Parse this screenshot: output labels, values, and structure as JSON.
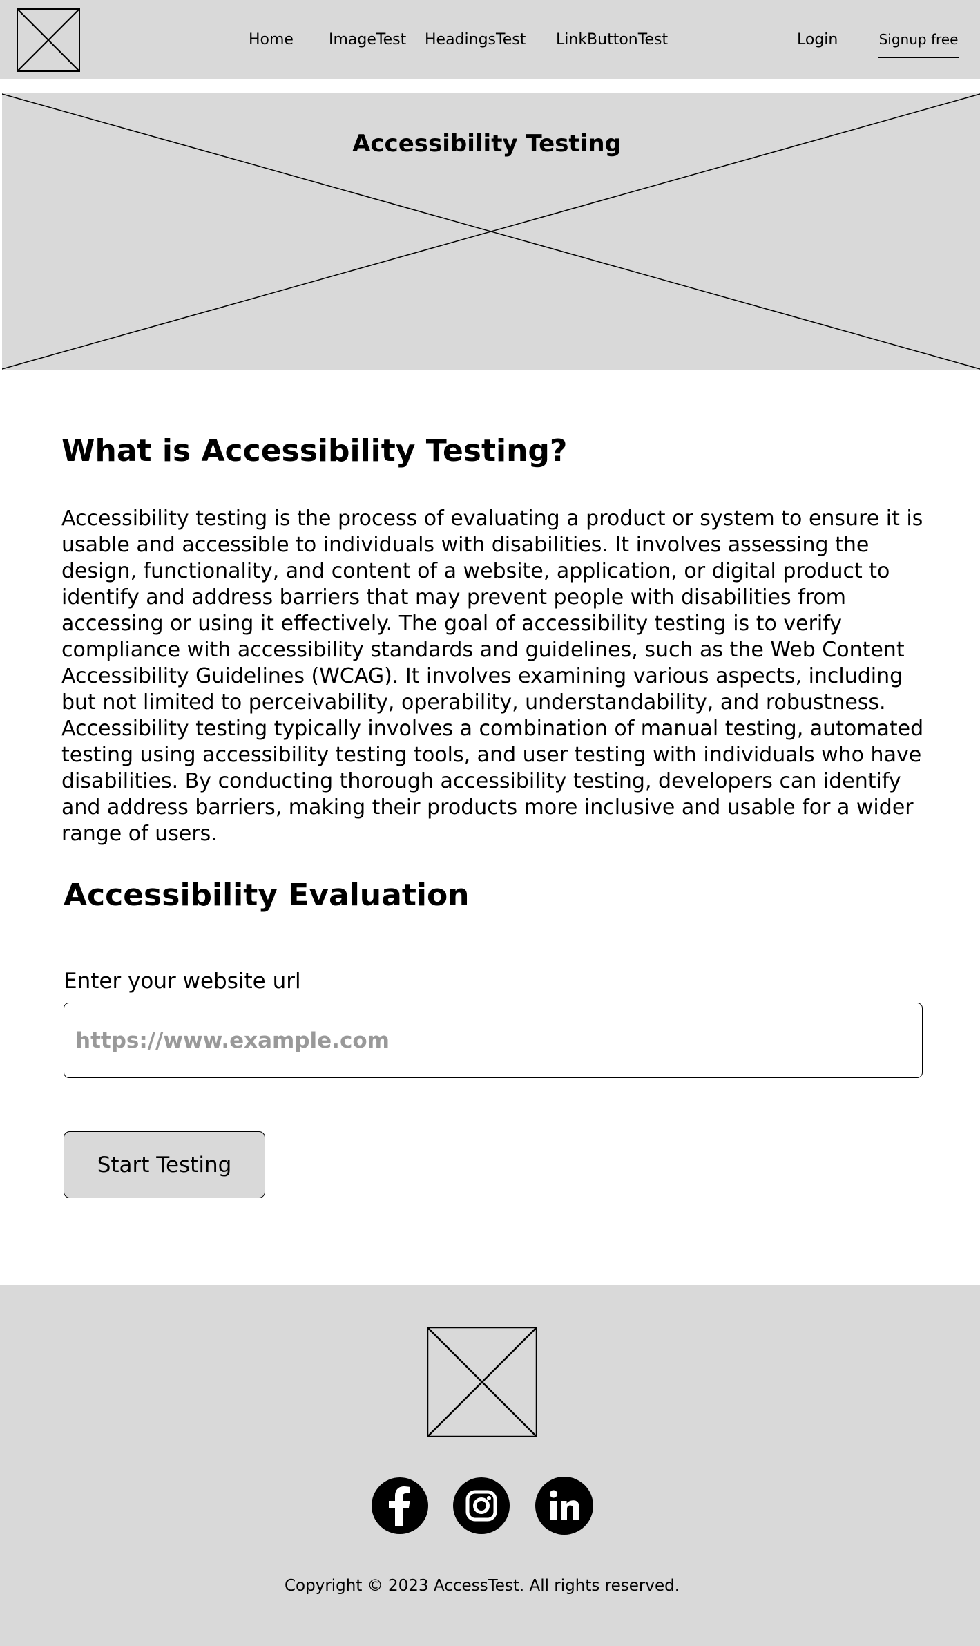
{
  "header": {
    "logo_icon": "image-placeholder-icon",
    "nav": [
      "Home",
      "ImageTest",
      "HeadingsTest",
      "LinkButtonTest"
    ],
    "login": "Login",
    "signup": "Signup free"
  },
  "hero": {
    "image_icon": "image-placeholder-icon",
    "title": "Accessibility Testing"
  },
  "main": {
    "heading": "What is Accessibility Testing?",
    "paragraph": "Accessibility testing is the process of evaluating a product or system to ensure it is usable and accessible to individuals with disabilities. It involves assessing the design, functionality, and content of a website, application, or digital product to identify and address barriers that may prevent people with disabilities from accessing or using it effectively. The goal of accessibility testing is to verify compliance with accessibility standards and guidelines, such as the Web Content Accessibility Guidelines (WCAG). It involves examining various aspects, including but not limited to perceivability, operability, understandability, and robustness. Accessibility testing typically involves a combination of manual testing, automated testing using accessibility testing tools, and user testing with individuals who have disabilities. By conducting thorough accessibility testing, developers can identify and address barriers, making their products more inclusive and usable for a wider range of users."
  },
  "evaluation": {
    "heading": "Accessibility Evaluation",
    "input_label": "Enter your website url",
    "input_placeholder": "https://www.example.com",
    "input_value": "",
    "button": "Start Testing"
  },
  "footer": {
    "logo_icon": "image-placeholder-icon",
    "social_icons": [
      "facebook-icon",
      "instagram-icon",
      "linkedin-icon"
    ],
    "copyright": "Copyright © 2023 AccessTest. All rights reserved."
  },
  "colors": {
    "placeholder_gray": "#d9d9d9",
    "text": "#000000",
    "input_placeholder": "#999999",
    "background": "#ffffff"
  }
}
